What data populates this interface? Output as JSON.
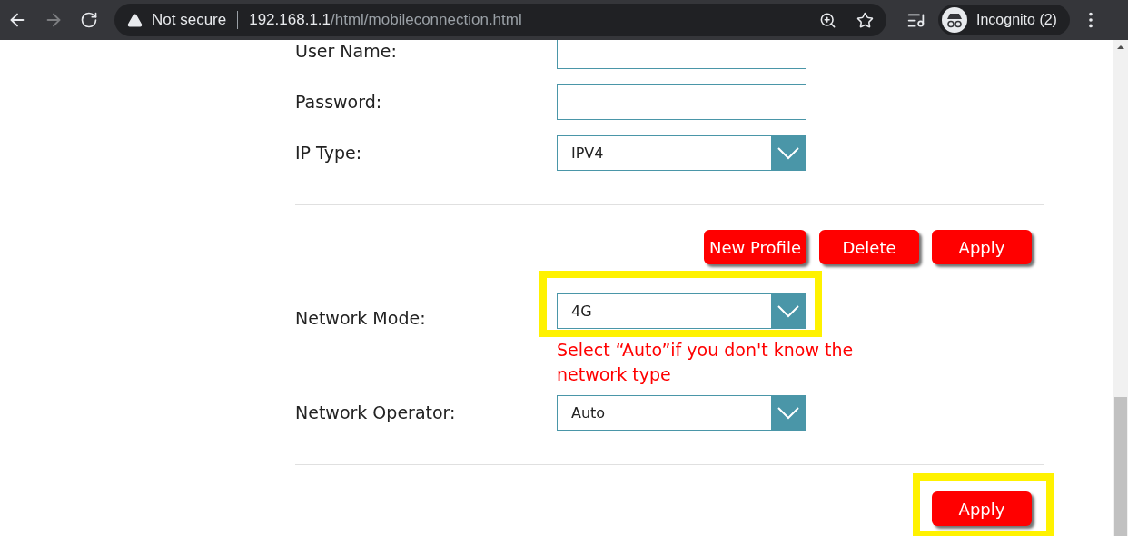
{
  "browser": {
    "forward_enabled": false,
    "security_label": "Not secure",
    "url_host": "192.168.1.1",
    "url_path": "/html/mobileconnection.html",
    "profile": "Incognito (2)"
  },
  "fields": [
    {
      "kind": "text",
      "label": "User Name:"
    },
    {
      "kind": "password",
      "label": "Password:"
    },
    {
      "kind": "select",
      "label": "IP Type:",
      "value": "IPV4"
    }
  ],
  "profile_buttons": [
    "New Profile",
    "Delete",
    "Apply"
  ],
  "network_mode": {
    "label": "Network Mode:",
    "value": "4G",
    "highlighted": true,
    "hint": "Select “Auto”if you don't know the network type"
  },
  "network_operator": {
    "label": "Network Operator:",
    "value": "Auto"
  },
  "apply_button": {
    "label": "Apply",
    "highlighted": true
  }
}
